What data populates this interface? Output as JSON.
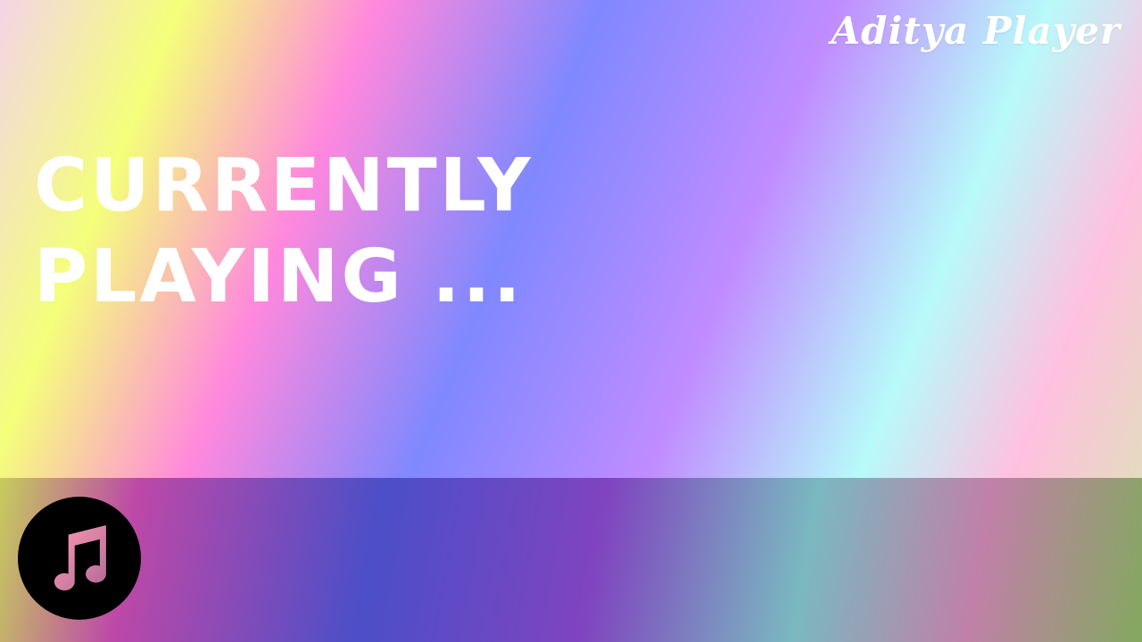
{
  "header": {
    "brand": "Aditya Player"
  },
  "main": {
    "status_line1": "CURRENTLY",
    "status_line2": "PLAYING ..."
  },
  "player_bar": {
    "album_icon": "music-note-icon",
    "icon_gradient": [
      "#ff9ab0",
      "#b06a98"
    ]
  },
  "colors": {
    "text": "#ffffff",
    "icon_bg": "#000000"
  }
}
